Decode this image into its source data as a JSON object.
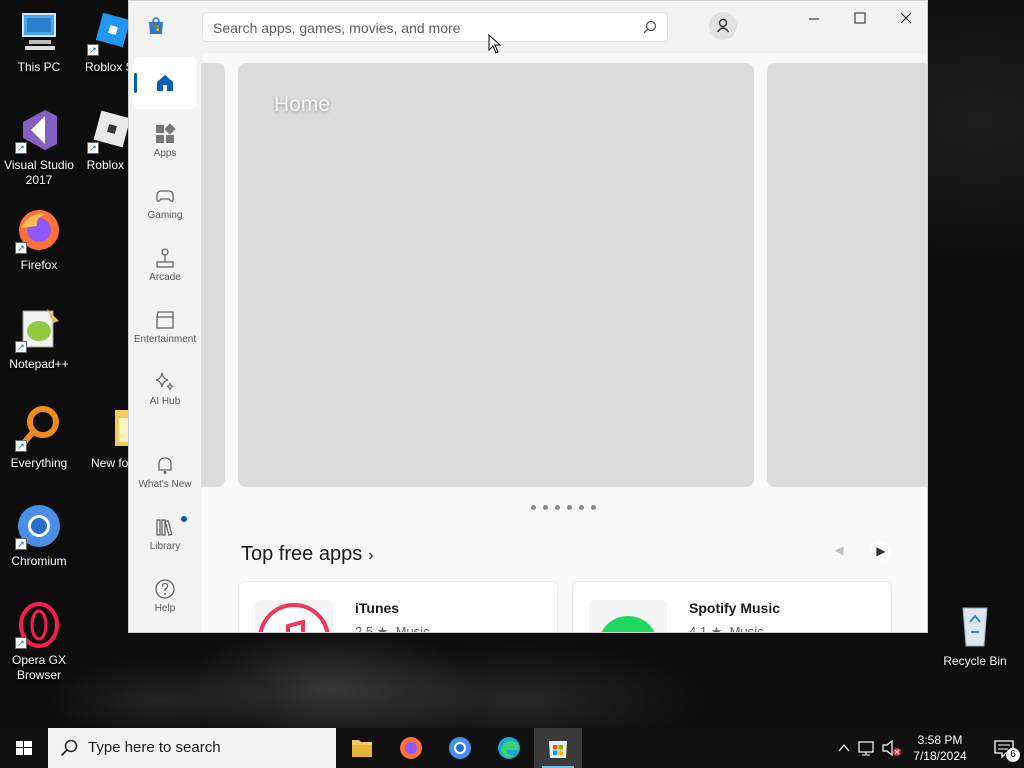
{
  "desktop": {
    "icons": [
      {
        "label": "This PC"
      },
      {
        "label": "Roblox St"
      },
      {
        "label": "Visual Studio 2017"
      },
      {
        "label": "Roblox P"
      },
      {
        "label": "Firefox"
      },
      {
        "label": "Notepad++"
      },
      {
        "label": "Everything"
      },
      {
        "label": "New fol"
      },
      {
        "label": "Chromium"
      },
      {
        "label": "Opera GX Browser"
      },
      {
        "label": "Recycle Bin"
      }
    ]
  },
  "store": {
    "search_placeholder": "Search apps, games, movies, and more",
    "nav": [
      {
        "label": "Home",
        "icon": "home-icon"
      },
      {
        "label": "Apps",
        "icon": "apps-icon"
      },
      {
        "label": "Gaming",
        "icon": "gamepad-icon"
      },
      {
        "label": "Arcade",
        "icon": "joystick-icon"
      },
      {
        "label": "Entertainment",
        "icon": "clapperboard-icon"
      },
      {
        "label": "AI Hub",
        "icon": "sparkle-icon"
      },
      {
        "label": "What's New",
        "icon": "bell-icon"
      },
      {
        "label": "Library",
        "icon": "library-icon"
      },
      {
        "label": "Help",
        "icon": "help-icon"
      }
    ],
    "hero_title": "Home",
    "carousel_page_count": 6,
    "section_title": "Top free apps",
    "apps": [
      {
        "name": "iTunes",
        "rating": "2.5 ★",
        "category": "Music"
      },
      {
        "name": "Spotify Music",
        "rating": "4.1 ★",
        "category": "Music"
      }
    ],
    "accent_color": "#005fb8"
  },
  "taskbar": {
    "search_placeholder": "Type here to search",
    "apps": [
      "File Explorer",
      "Firefox",
      "Chromium",
      "Microsoft Edge",
      "Microsoft Store"
    ],
    "time": "3:58 PM",
    "date": "7/18/2024",
    "notification_count": "6"
  }
}
